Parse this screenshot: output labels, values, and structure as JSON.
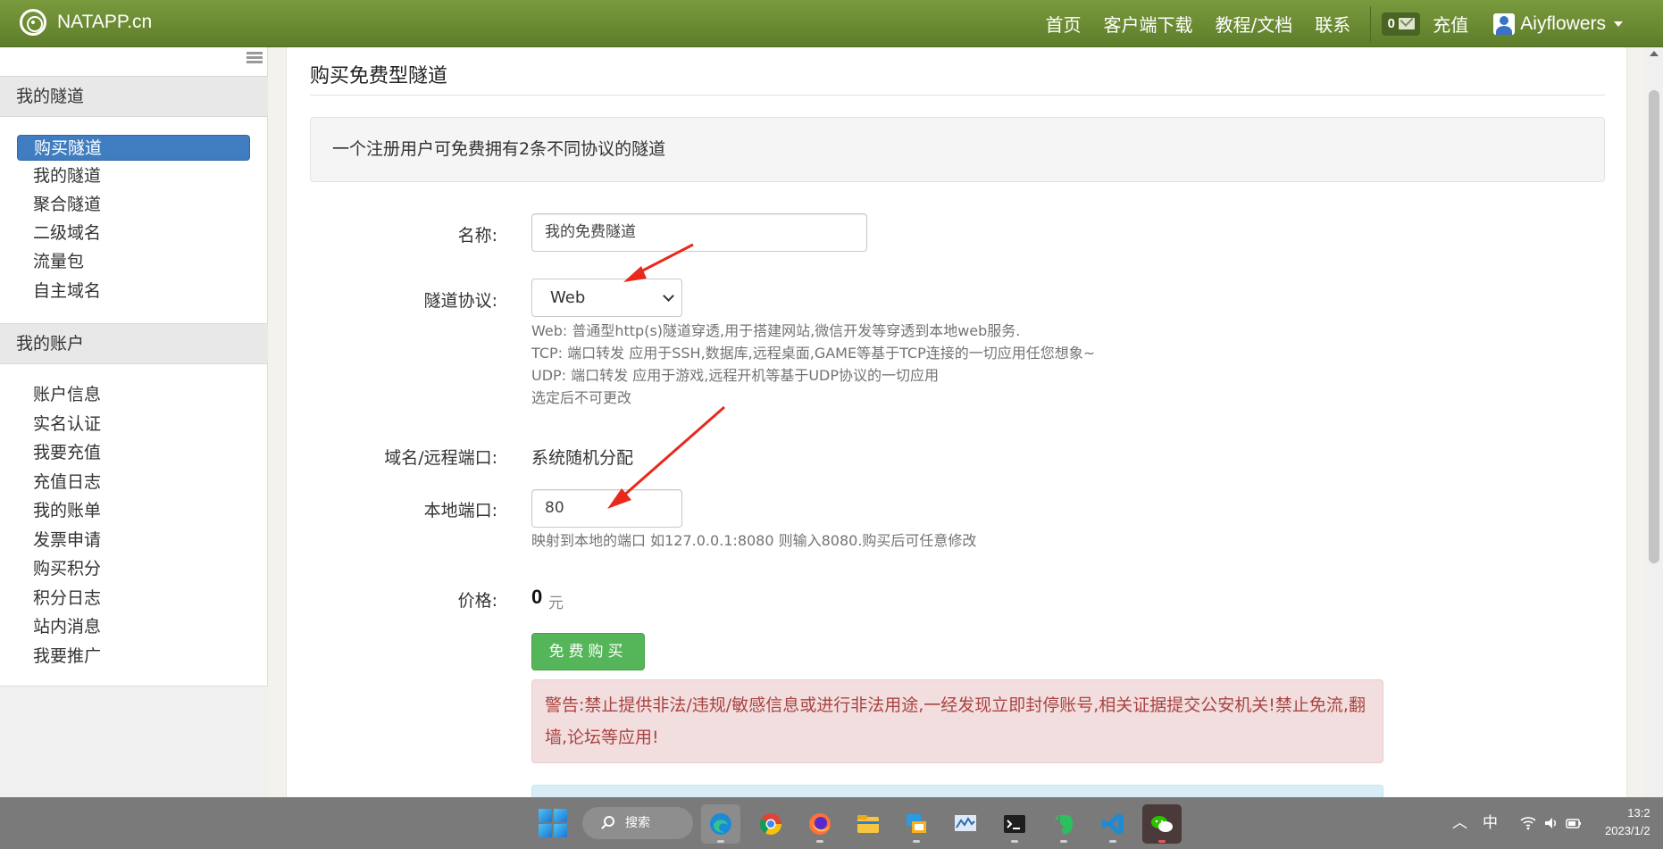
{
  "navbar": {
    "brand": "NATAPP.cn",
    "links": [
      "首页",
      "客户端下载",
      "教程/文档",
      "联系"
    ],
    "mail_count": "0",
    "recharge": "充值",
    "username": "Aiyflowers"
  },
  "sidebar": {
    "section1_title": "我的隧道",
    "section1_items": [
      "购买隧道",
      "我的隧道",
      "聚合隧道",
      "二级域名",
      "流量包",
      "自主域名"
    ],
    "section2_title": "我的账户",
    "section2_items": [
      "账户信息",
      "实名认证",
      "我要充值",
      "充值日志",
      "我的账单",
      "发票申请",
      "购买积分",
      "积分日志",
      "站内消息",
      "我要推广"
    ]
  },
  "main": {
    "title": "购买免费型隧道",
    "notice": "一个注册用户可免费拥有2条不同协议的隧道",
    "form": {
      "name_label": "名称:",
      "name_value": "我的免费隧道",
      "protocol_label": "隧道协议:",
      "protocol_value": "Web",
      "protocol_help": [
        "Web: 普通型http(s)隧道穿透,用于搭建网站,微信开发等穿透到本地web服务.",
        "TCP: 端口转发 应用于SSH,数据库,远程桌面,GAME等基于TCP连接的一切应用任您想象~",
        "UDP: 端口转发 应用于游戏,远程开机等基于UDP协议的一切应用",
        "选定后不可更改"
      ],
      "domain_label": "域名/远程端口:",
      "domain_value": "系统随机分配",
      "port_label": "本地端口:",
      "port_value": "80",
      "port_help": "映射到本地的端口 如127.0.0.1:8080 则输入8080.购买后可任意修改",
      "price_label": "价格:",
      "price_value": "0",
      "price_unit": "元",
      "buy_button": "免费购买"
    },
    "warning": "警告:禁止提供非法/违规/敏感信息或进行非法用途,一经发现立即封停账号,相关证据提交公安机关!禁止免流,翻墙,论坛等应用!"
  },
  "taskbar": {
    "search": "搜索",
    "apps": [
      "edge-icon",
      "chrome-icon",
      "firefox-icon",
      "file-explorer-icon",
      "remote-desktop-icon",
      "monitor-icon",
      "terminal-icon",
      "evernote-icon",
      "vscode-icon",
      "wechat-icon"
    ],
    "ime": "中",
    "time": "13:2",
    "date": "2023/1/2"
  },
  "colors": {
    "navbar": "#6b8a34",
    "active_nav": "#3f7dc0",
    "buy_button": "#55b559",
    "warning_bg": "#f2dede",
    "warning_text": "#a94442",
    "annotation_arrow": "#e8291c"
  }
}
